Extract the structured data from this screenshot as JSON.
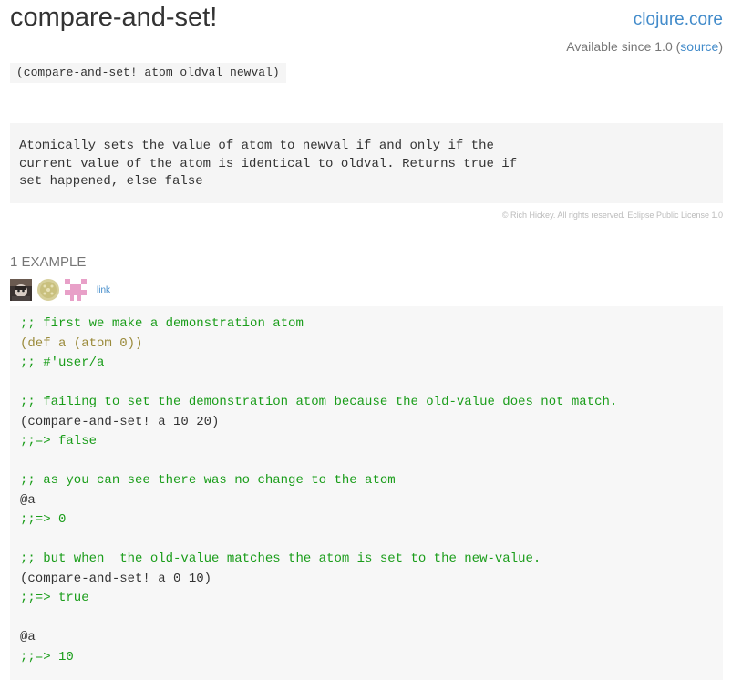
{
  "header": {
    "title": "compare-and-set!",
    "namespace": "clojure.core",
    "available_prefix": "Available since 1.0 (",
    "source_link": "source",
    "available_suffix": ")"
  },
  "signature": "(compare-and-set! atom oldval newval)",
  "docstring": [
    "Atomically sets the value of atom to newval if and only if the",
    "current value of the atom is identical to oldval. Returns true if",
    "set happened, else false"
  ],
  "copyright": "© Rich Hickey. All rights reserved. Eclipse Public License 1.0",
  "examples": {
    "heading": "1 EXAMPLE",
    "contributors": [
      {
        "icon": "user-avatar-photo-icon",
        "color": "#5a4a40"
      },
      {
        "icon": "user-avatar-identicon-round-icon",
        "color": "#c8c08a"
      },
      {
        "icon": "user-avatar-identicon-pink-icon",
        "color": "#e8a0c8"
      }
    ],
    "link_label": "link",
    "code_lines": [
      ";; first we make a demonstration atom",
      "(def a (atom 0))",
      ";; #'user/a",
      "",
      ";; failing to set the demonstration atom because the old-value does not match.",
      "(compare-and-set! a 10 20)",
      ";;=> false",
      "",
      ";; as you can see there was no change to the atom",
      "@a",
      ";;=> 0",
      "",
      ";; but when  the old-value matches the atom is set to the new-value.",
      "(compare-and-set! a 0 10)",
      ";;=> true",
      "",
      "@a",
      ";;=> 10"
    ]
  },
  "colors": {
    "link": "#428bca",
    "comment": "#1a9d1a",
    "code_background": "#f7f7f7"
  }
}
